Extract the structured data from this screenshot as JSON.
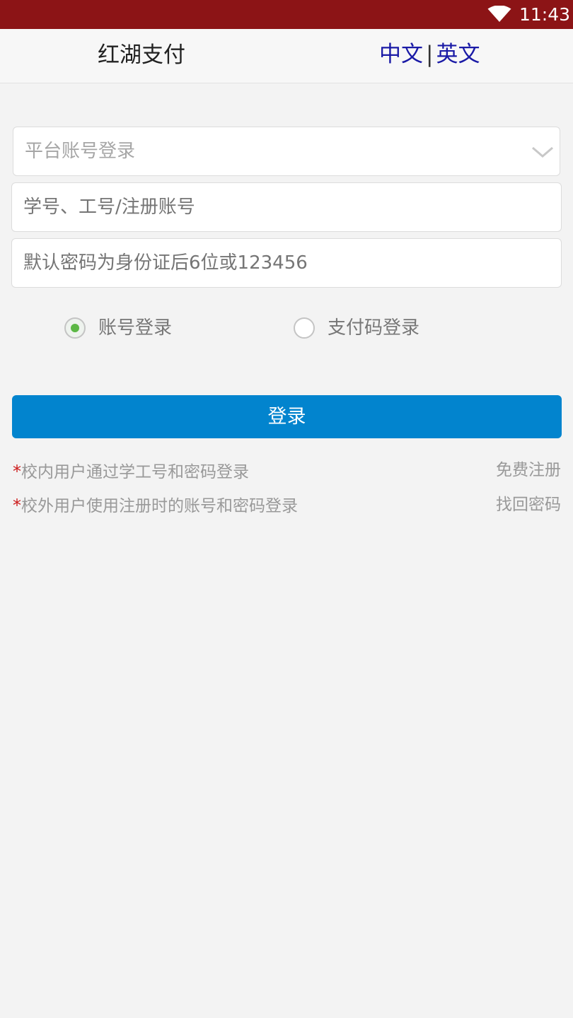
{
  "status_bar": {
    "time": "11:43",
    "icons": [
      "wifi-icon"
    ],
    "background": "#8c1416"
  },
  "header": {
    "title": "红湖支付",
    "lang_chinese": "中文",
    "lang_separator": "|",
    "lang_english": "英文",
    "lang_color": "#1a1aa6"
  },
  "form": {
    "login_type_select": {
      "selected": "平台账号登录",
      "icon": "chevron-down-icon"
    },
    "account_field": {
      "placeholder": "学号、工号/注册账号",
      "value": ""
    },
    "password_field": {
      "placeholder": "默认密码为身份证后6位或123456",
      "value": ""
    },
    "radio_options": [
      {
        "label": "账号登录",
        "selected": true
      },
      {
        "label": "支付码登录",
        "selected": false
      }
    ],
    "login_button": {
      "label": "登录",
      "color": "#0284ce"
    }
  },
  "notes": [
    {
      "marker": "*",
      "text": "校内用户通过学工号和密码登录"
    },
    {
      "marker": "*",
      "text": "校外用户使用注册时的账号和密码登录"
    }
  ],
  "links": {
    "register": "免费注册",
    "recover_password": "找回密码"
  },
  "colors": {
    "accent_radio": "#5cb845",
    "required_marker": "#cc1b1b"
  }
}
